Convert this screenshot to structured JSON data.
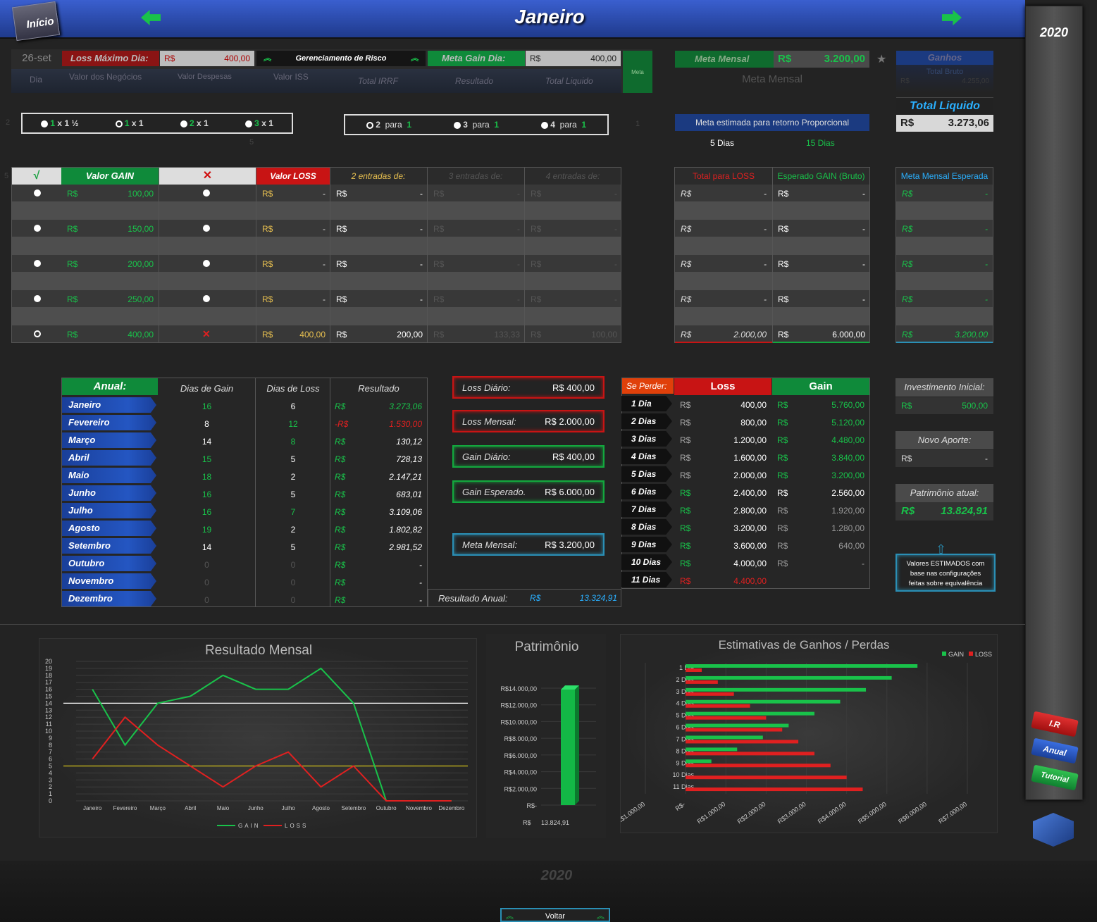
{
  "header": {
    "home": "Início",
    "month": "Janeiro",
    "year_side": "2020",
    "year_bottom": "2020",
    "back": "Voltar"
  },
  "top": {
    "date": "26-set",
    "loss_max_label": "Loss Máximo Dia:",
    "loss_max_cur": "R$",
    "loss_max_val": "400,00",
    "risk_label": "Gerenciamento de Risco",
    "meta_gain_label": "Meta Gain Dia:",
    "meta_gain_cur": "R$",
    "meta_gain_val": "400,00",
    "meta_small": "Meta",
    "meta_mensal_label": "Meta Mensal",
    "meta_mensal_cur": "R$",
    "meta_mensal_val": "3.200,00",
    "meta_mensal_sub": "Meta Mensal",
    "ganhos_label": "Ganhos",
    "total_bruto_label": "Total Bruto",
    "tb_cur": "R$",
    "tb_val": "4.255,00",
    "total_liquido_label": "Total Liquido",
    "tl_cur": "R$",
    "tl_val": "3.273,06",
    "cols": [
      "Dia",
      "Valor dos Negócios",
      "Valor Despesas",
      "Valor ISS",
      "Total IRRF",
      "Resultado",
      "Total Liquido"
    ]
  },
  "ratios": [
    {
      "a": "1",
      "sep": "x",
      "b": "1 ½"
    },
    {
      "a": "1",
      "sep": "x",
      "b": "1"
    },
    {
      "a": "2",
      "sep": "x",
      "b": "1"
    },
    {
      "a": "3",
      "sep": "x",
      "b": "1"
    }
  ],
  "ratio_side_left": "2",
  "entries": [
    {
      "a": "2",
      "sep": "para",
      "b": "1"
    },
    {
      "a": "3",
      "sep": "para",
      "b": "1"
    },
    {
      "a": "4",
      "sep": "para",
      "b": "1"
    }
  ],
  "entries_side_right": "1",
  "small_five": "5",
  "meta_estimada": {
    "label": "Meta estimada para retorno Proporcional",
    "d5": "5 Dias",
    "d15": "15 Dias"
  },
  "gain_table": {
    "row_index": "5",
    "check": "√",
    "x": "✕",
    "valor_gain": "Valor GAIN",
    "valor_loss": "Valor LOSS",
    "e2": "2 entradas de:",
    "e3": "3 entradas de:",
    "e4": "4 entradas de:",
    "total_loss": "Total para LOSS",
    "esperado_gain": "Esperado GAIN (Bruto)",
    "meta_esperada": "Meta Mensal Esperada",
    "cur": "R$",
    "dash": "-",
    "rows": [
      {
        "gain": "100,00"
      },
      {
        "gain": "150,00"
      },
      {
        "gain": "200,00"
      },
      {
        "gain": "250,00"
      }
    ],
    "last": {
      "gain": "400,00",
      "loss": "400,00",
      "e2": "200,00",
      "e3": "133,33",
      "e4": "100,00",
      "total_loss": "2.000,00",
      "esperado": "6.000,00",
      "meta": "3.200,00"
    }
  },
  "annual": {
    "label": "Anual:",
    "dias_gain": "Dias de Gain",
    "dias_loss": "Dias de Loss",
    "resultado": "Resultado",
    "cur": "R$",
    "neg_cur": "-R$",
    "rows": [
      {
        "m": "Janeiro",
        "g": "16",
        "l": "6",
        "r": "3.273,06",
        "gc": "green",
        "lc": "white",
        "rc": "green"
      },
      {
        "m": "Fevereiro",
        "g": "8",
        "l": "12",
        "r": "1.530,00",
        "gc": "white",
        "lc": "green",
        "rc": "red"
      },
      {
        "m": "Março",
        "g": "14",
        "l": "8",
        "r": "130,12",
        "gc": "white",
        "lc": "green",
        "rc": "white"
      },
      {
        "m": "Abril",
        "g": "15",
        "l": "5",
        "r": "728,13",
        "gc": "green",
        "lc": "white",
        "rc": "white"
      },
      {
        "m": "Maio",
        "g": "18",
        "l": "2",
        "r": "2.147,21",
        "gc": "green",
        "lc": "white",
        "rc": "white"
      },
      {
        "m": "Junho",
        "g": "16",
        "l": "5",
        "r": "683,01",
        "gc": "green",
        "lc": "white",
        "rc": "white"
      },
      {
        "m": "Julho",
        "g": "16",
        "l": "7",
        "r": "3.109,06",
        "gc": "green",
        "lc": "green",
        "rc": "white"
      },
      {
        "m": "Agosto",
        "g": "19",
        "l": "2",
        "r": "1.802,82",
        "gc": "green",
        "lc": "white",
        "rc": "white"
      },
      {
        "m": "Setembro",
        "g": "14",
        "l": "5",
        "r": "2.981,52",
        "gc": "white",
        "lc": "white",
        "rc": "white"
      },
      {
        "m": "Outubro",
        "g": "0",
        "l": "0",
        "r": "-",
        "gc": "dgrey",
        "lc": "dgrey",
        "rc": "white"
      },
      {
        "m": "Novembro",
        "g": "0",
        "l": "0",
        "r": "-",
        "gc": "dgrey",
        "lc": "dgrey",
        "rc": "white"
      },
      {
        "m": "Dezembro",
        "g": "0",
        "l": "0",
        "r": "-",
        "gc": "dgrey",
        "lc": "dgrey",
        "rc": "white"
      }
    ],
    "resultado_anual_label": "Resultado Anual:",
    "resultado_anual_cur": "R$",
    "resultado_anual_val": "13.324,91"
  },
  "summary_boxes": {
    "loss_diario": {
      "label": "Loss Diário:",
      "value": "R$  400,00"
    },
    "loss_mensal": {
      "label": "Loss Mensal:",
      "value": "R$  2.000,00"
    },
    "gain_diario": {
      "label": "Gain Diário:",
      "value": "R$  400,00"
    },
    "gain_esperado": {
      "label": "Gain Esperado.",
      "value": "R$  6.000,00"
    },
    "meta_mensal": {
      "label": "Meta Mensal:",
      "value": "R$  3.200,00"
    }
  },
  "se_perder": {
    "label": "Se Perder:",
    "loss": "Loss",
    "gain": "Gain",
    "cur": "R$",
    "rows": [
      {
        "d": "1 Dia",
        "l": "400,00",
        "g": "5.760,00"
      },
      {
        "d": "2 Dias",
        "l": "800,00",
        "g": "5.120,00"
      },
      {
        "d": "3 Dias",
        "l": "1.200,00",
        "g": "4.480,00"
      },
      {
        "d": "4 Dias",
        "l": "1.600,00",
        "g": "3.840,00"
      },
      {
        "d": "5 Dias",
        "l": "2.000,00",
        "g": "3.200,00"
      },
      {
        "d": "6 Dias",
        "l": "2.400,00",
        "g": "2.560,00"
      },
      {
        "d": "7 Dias",
        "l": "2.800,00",
        "g": "1.920,00"
      },
      {
        "d": "8 Dias",
        "l": "3.200,00",
        "g": "1.280,00"
      },
      {
        "d": "9 Dias",
        "l": "3.600,00",
        "g": "640,00"
      },
      {
        "d": "10 Dias",
        "l": "4.000,00",
        "g": "-"
      },
      {
        "d": "11 Dias",
        "l": "4.400,00",
        "g": ""
      }
    ]
  },
  "right_panel": {
    "inv_label": "Investimento Inicial:",
    "inv_cur": "R$",
    "inv_val": "500,00",
    "aporte_label": "Novo Aporte:",
    "aporte_cur": "R$",
    "aporte_val": "-",
    "patrimonio_label": "Patrimônio atual:",
    "patrimonio_cur": "R$",
    "patrimonio_val": "13.824,91",
    "note": "Valores ESTIMADOS com base nas configurações feitas sobre equivalência"
  },
  "side_buttons": {
    "ir": "I.R",
    "anual": "Anual",
    "tutorial": "Tutorial"
  },
  "colors": {
    "gain": "#19c24a",
    "loss": "#e02020",
    "blue": "#2456c2"
  },
  "chart_data": [
    {
      "type": "line",
      "title": "Resultado Mensal",
      "categories": [
        "Janeiro",
        "Fevereiro",
        "Março",
        "Abril",
        "Maio",
        "Junho",
        "Julho",
        "Agosto",
        "Setembro",
        "Outubro",
        "Novembro",
        "Dezembro"
      ],
      "series": [
        {
          "name": "GAIN",
          "color": "#19c24a",
          "values": [
            16,
            8,
            14,
            15,
            18,
            16,
            16,
            19,
            14,
            0,
            0,
            0
          ]
        },
        {
          "name": "LOSS",
          "color": "#e02020",
          "values": [
            6,
            12,
            8,
            5,
            2,
            5,
            7,
            2,
            5,
            0,
            0,
            0
          ]
        }
      ],
      "ref_lines": [
        {
          "value": 14,
          "color": "#ffffff"
        },
        {
          "value": 5,
          "color": "#d4c21a"
        }
      ],
      "ylim": [
        0,
        20
      ],
      "yticks": [
        "0",
        "1",
        "2",
        "3",
        "4",
        "5",
        "6",
        "7",
        "8",
        "9",
        "10",
        "11",
        "12",
        "13",
        "14",
        "15",
        "16",
        "17",
        "18",
        "19",
        "20"
      ],
      "legend": "bottom"
    },
    {
      "type": "bar",
      "title": "Patrimônio",
      "categories": [
        "R$"
      ],
      "values": [
        13824.91
      ],
      "value_label": "13.824,91",
      "yticks": [
        "R$14.000,00",
        "R$12.000,00",
        "R$10.000,00",
        "R$8.000,00",
        "R$6.000,00",
        "R$4.000,00",
        "R$2.000,00",
        "R$-"
      ],
      "ylim": [
        0,
        14000
      ]
    },
    {
      "type": "bar",
      "orientation": "horizontal",
      "title": "Estimativas de Ganhos / Perdas",
      "categories": [
        "1 Dia",
        "2 Dias",
        "3 Dias",
        "4 Dias",
        "5 Dias",
        "6 Dias",
        "7 Dias",
        "8 Dias",
        "9 Dias",
        "10 Dias",
        "11 Dias"
      ],
      "series": [
        {
          "name": "GAIN",
          "color": "#19c24a",
          "values": [
            5760,
            5120,
            4480,
            3840,
            3200,
            2560,
            1920,
            1280,
            640,
            0,
            0
          ]
        },
        {
          "name": "LOSS",
          "color": "#e02020",
          "values": [
            400,
            800,
            1200,
            1600,
            2000,
            2400,
            2800,
            3200,
            3600,
            4000,
            4400
          ]
        }
      ],
      "xlim": [
        -1000,
        7000
      ],
      "xticks": [
        "-R$1.000,00",
        "R$-",
        "R$1.000,00",
        "R$2.000,00",
        "R$3.000,00",
        "R$4.000,00",
        "R$5.000,00",
        "R$6.000,00",
        "R$7.000,00"
      ],
      "legend": "top-right"
    }
  ]
}
